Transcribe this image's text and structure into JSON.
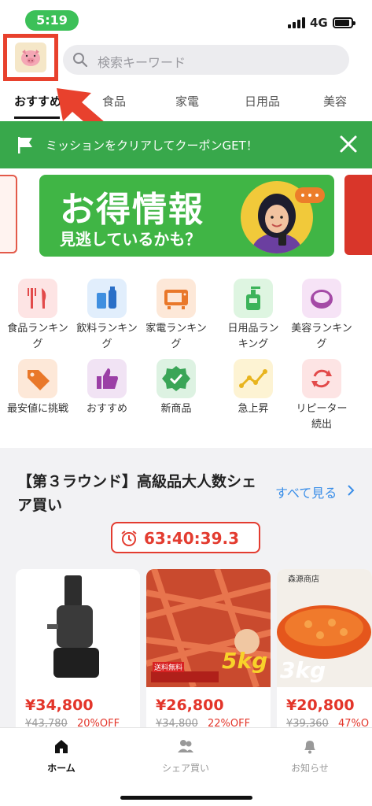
{
  "status_bar": {
    "time": "5:19",
    "network": "4G"
  },
  "search": {
    "placeholder": "検索キーワード"
  },
  "tabs": [
    {
      "label": "おすすめ",
      "active": true
    },
    {
      "label": "食品"
    },
    {
      "label": "家電"
    },
    {
      "label": "日用品"
    },
    {
      "label": "美容"
    }
  ],
  "mission_banner": {
    "text": "ミッションをクリアしてクーポンGET！"
  },
  "promo": {
    "title": "お得情報",
    "subtitle": "見逃しているかも？"
  },
  "categories": [
    {
      "label": "食品ランキング",
      "icon": "fork-knife-icon"
    },
    {
      "label": "飲料ランキング",
      "icon": "bottles-icon"
    },
    {
      "label": "家電ランキング",
      "icon": "tv-icon"
    },
    {
      "label": "日用品ランキング",
      "icon": "pump-bottle-icon"
    },
    {
      "label": "美容ランキング",
      "icon": "compact-icon"
    },
    {
      "label": "最安値に挑戦",
      "icon": "price-tag-icon"
    },
    {
      "label": "おすすめ",
      "icon": "thumbs-up-icon"
    },
    {
      "label": "新商品",
      "icon": "check-badge-icon"
    },
    {
      "label": "急上昇",
      "icon": "trend-line-icon"
    },
    {
      "label": "リピーター続出",
      "icon": "repeat-icon"
    }
  ],
  "round": {
    "title": "【第３ラウンド】高級品大人数シェア買い",
    "see_all": "すべて見る",
    "timer": "63:40:39.3"
  },
  "products": [
    {
      "price": "¥34,800",
      "old_price": "¥43,780",
      "discount": "20%OFF"
    },
    {
      "price": "¥26,800",
      "old_price": "¥34,800",
      "discount": "22%OFF",
      "badge": "5kg",
      "tag": "送料無料"
    },
    {
      "price": "¥20,800",
      "old_price": "¥39,360",
      "discount": "47%O",
      "badge": "3kg",
      "shop": "森源商店"
    }
  ],
  "bottom_nav": [
    {
      "label": "ホーム",
      "active": true
    },
    {
      "label": "シェア買い"
    },
    {
      "label": "お知らせ"
    }
  ],
  "colors": {
    "brand_green": "#38a84b",
    "accent_red": "#e3352a",
    "link_blue": "#3a8ee8",
    "annotation_red": "#e8412d"
  }
}
